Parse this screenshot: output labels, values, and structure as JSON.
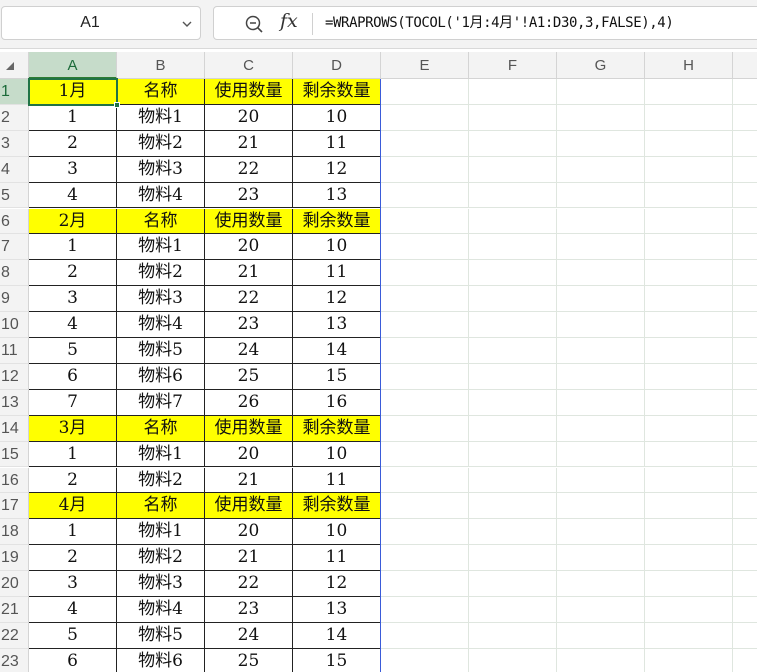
{
  "name_box": {
    "value": "A1"
  },
  "formula_bar": {
    "formula": "=WRAPROWS(TOCOL('1月:4月'!A1:D30,3,FALSE),4)"
  },
  "icons": {
    "zoom": "zoom-out-icon",
    "function": "fx-icon",
    "dropdown": "chevron-down-icon",
    "select_all": "select-all-triangle-icon"
  },
  "colors": {
    "header_fill": "#ffff00",
    "selection": "#217346"
  },
  "grid": {
    "columns": [
      "A",
      "B",
      "C",
      "D",
      "E",
      "F",
      "G",
      "H"
    ],
    "selected_cell": "A1",
    "rows": [
      {
        "num": "1",
        "header": true,
        "cells": [
          "1月",
          "名称",
          "使用数量",
          "剩余数量"
        ]
      },
      {
        "num": "2",
        "header": false,
        "cells": [
          "1",
          "物料1",
          "20",
          "10"
        ]
      },
      {
        "num": "3",
        "header": false,
        "cells": [
          "2",
          "物料2",
          "21",
          "11"
        ]
      },
      {
        "num": "4",
        "header": false,
        "cells": [
          "3",
          "物料3",
          "22",
          "12"
        ]
      },
      {
        "num": "5",
        "header": false,
        "cells": [
          "4",
          "物料4",
          "23",
          "13"
        ]
      },
      {
        "num": "6",
        "header": true,
        "cells": [
          "2月",
          "名称",
          "使用数量",
          "剩余数量"
        ]
      },
      {
        "num": "7",
        "header": false,
        "cells": [
          "1",
          "物料1",
          "20",
          "10"
        ]
      },
      {
        "num": "8",
        "header": false,
        "cells": [
          "2",
          "物料2",
          "21",
          "11"
        ]
      },
      {
        "num": "9",
        "header": false,
        "cells": [
          "3",
          "物料3",
          "22",
          "12"
        ]
      },
      {
        "num": "10",
        "header": false,
        "cells": [
          "4",
          "物料4",
          "23",
          "13"
        ]
      },
      {
        "num": "11",
        "header": false,
        "cells": [
          "5",
          "物料5",
          "24",
          "14"
        ]
      },
      {
        "num": "12",
        "header": false,
        "cells": [
          "6",
          "物料6",
          "25",
          "15"
        ]
      },
      {
        "num": "13",
        "header": false,
        "cells": [
          "7",
          "物料7",
          "26",
          "16"
        ]
      },
      {
        "num": "14",
        "header": true,
        "cells": [
          "3月",
          "名称",
          "使用数量",
          "剩余数量"
        ]
      },
      {
        "num": "15",
        "header": false,
        "cells": [
          "1",
          "物料1",
          "20",
          "10"
        ]
      },
      {
        "num": "16",
        "header": false,
        "cells": [
          "2",
          "物料2",
          "21",
          "11"
        ]
      },
      {
        "num": "17",
        "header": true,
        "cells": [
          "4月",
          "名称",
          "使用数量",
          "剩余数量"
        ]
      },
      {
        "num": "18",
        "header": false,
        "cells": [
          "1",
          "物料1",
          "20",
          "10"
        ]
      },
      {
        "num": "19",
        "header": false,
        "cells": [
          "2",
          "物料2",
          "21",
          "11"
        ]
      },
      {
        "num": "20",
        "header": false,
        "cells": [
          "3",
          "物料3",
          "22",
          "12"
        ]
      },
      {
        "num": "21",
        "header": false,
        "cells": [
          "4",
          "物料4",
          "23",
          "13"
        ]
      },
      {
        "num": "22",
        "header": false,
        "cells": [
          "5",
          "物料5",
          "24",
          "14"
        ]
      },
      {
        "num": "23",
        "header": false,
        "cells": [
          "6",
          "物料6",
          "25",
          "15"
        ]
      }
    ]
  }
}
